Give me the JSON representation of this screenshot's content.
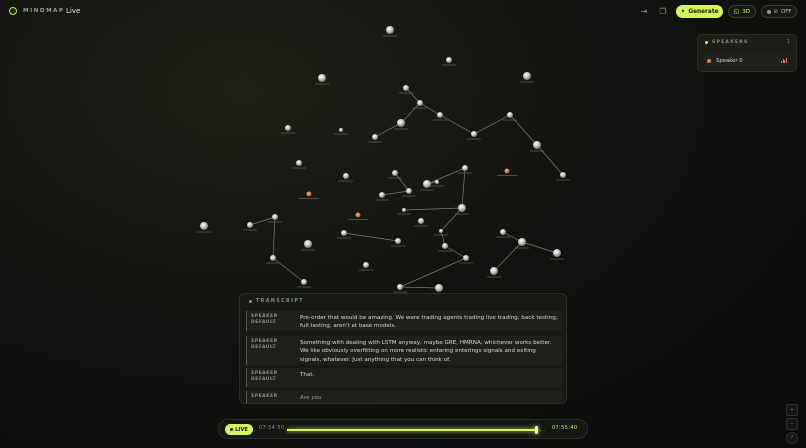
{
  "app": {
    "logo_text": "MINDMAP",
    "view_title": "Live"
  },
  "toolbar": {
    "icons": [
      "login-icon",
      "copy-icon"
    ],
    "generate_label": "Generate",
    "mode_label": "3D",
    "toggle_label": "OFF"
  },
  "speakers": {
    "header": "SPEAKERS",
    "count": "1",
    "items": [
      {
        "name": "Speaker 0",
        "color": "#e07d4a"
      }
    ]
  },
  "transcript": {
    "header": "TRANSCRIPT",
    "entries": [
      {
        "speaker": "SPEAKER DEFAULT",
        "text": "Pre-order that would be amazing. We were trading agents trading live trading, back testing, full testing, aren't at base models."
      },
      {
        "speaker": "SPEAKER DEFAULT",
        "text": "Something with dealing with LSTM anyway, maybe GRE, HMRNA, whichever works better. We like obviously overfitting on more realistic entering enterings signals and exiting signals, whatever. Just anything that you can think of."
      },
      {
        "speaker": "SPEAKER DEFAULT",
        "text": "That."
      },
      {
        "speaker": "SPEAKER",
        "text": "Are you",
        "partial": true
      }
    ]
  },
  "timeline": {
    "live_label": "LIVE",
    "start_time": "07:54:50",
    "end_time": "07:55:40",
    "progress": 0.96
  },
  "colors": {
    "accent": "#d3f565",
    "node": "#cfd2cc",
    "node_highlight": "#e07d4a",
    "edge": "#9a9d96",
    "background": "#121310"
  }
}
